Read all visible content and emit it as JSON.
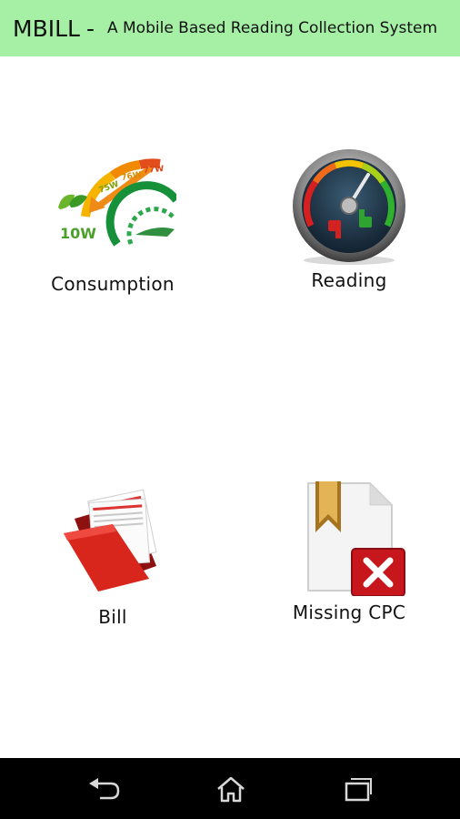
{
  "header": {
    "app_name": "MBILL",
    "separator": "-",
    "subtitle": "A Mobile Based Reading Collection System",
    "background_color": "#a6f0a6"
  },
  "menu": {
    "items": [
      {
        "label": "Consumption",
        "icon": "energy-consumption-icon"
      },
      {
        "label": "Reading",
        "icon": "speedometer-gauge-icon"
      },
      {
        "label": "Bill",
        "icon": "red-folder-icon"
      },
      {
        "label": "Missing CPC",
        "icon": "document-missing-icon"
      }
    ],
    "consumption_icon_text": {
      "low": "10W",
      "levels": [
        "75W",
        "76W",
        "77W"
      ]
    }
  },
  "navbar": {
    "back_icon": "back-icon",
    "home_icon": "home-icon",
    "recents_icon": "recents-icon"
  }
}
